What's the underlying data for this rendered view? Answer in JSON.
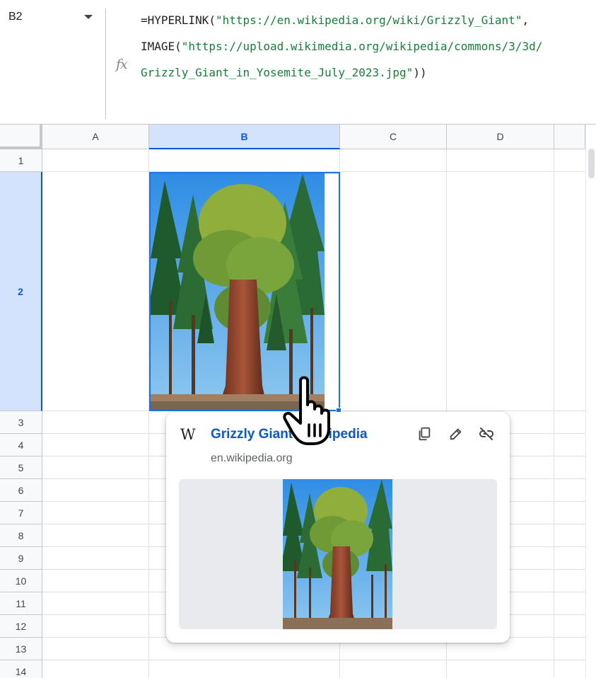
{
  "formula_bar": {
    "name_box": "B2",
    "fx_label": "fx",
    "formula_lines": [
      {
        "prefix": "=HYPERLINK(",
        "string": "\"https://en.wikipedia.org/wiki/Grizzly_Giant\"",
        "suffix": ","
      },
      {
        "prefix": "IMAGE(",
        "string": "\"https://upload.wikimedia.org/wikipedia/commons/3/3d/",
        "suffix": ""
      },
      {
        "prefix": "",
        "string": "Grizzly_Giant_in_Yosemite_July_2023.jpg\"",
        "suffix": "))"
      }
    ]
  },
  "grid": {
    "columns": [
      "A",
      "B",
      "C",
      "D"
    ],
    "rows": [
      "1",
      "2",
      "3",
      "4",
      "5",
      "6",
      "7",
      "8",
      "9",
      "10",
      "11",
      "12",
      "13",
      "14"
    ],
    "selected_column": "B",
    "selected_row": "2"
  },
  "link_card": {
    "site_icon": "W",
    "title": "Grizzly Giant - Wikipedia",
    "domain": "en.wikipedia.org",
    "actions": [
      "copy-icon",
      "edit-pencil-icon",
      "remove-link-icon"
    ]
  },
  "colors": {
    "accent": "#1a73e8",
    "link": "#0b57d0",
    "formula_string": "#188038",
    "selection_header": "#d3e3fd"
  }
}
